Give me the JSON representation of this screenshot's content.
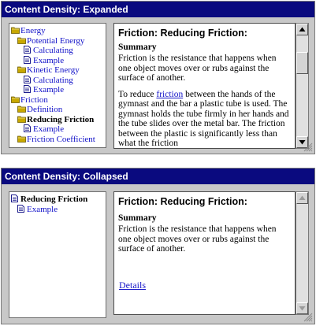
{
  "expanded": {
    "title": "Content Density: Expanded",
    "tree": [
      {
        "label": "Energy",
        "type": "folder",
        "level": 0
      },
      {
        "label": "Potential Energy",
        "type": "folder",
        "level": 1
      },
      {
        "label": "Calculating",
        "type": "doc",
        "level": 2
      },
      {
        "label": "Example",
        "type": "doc",
        "level": 2
      },
      {
        "label": "Kinetic Energy",
        "type": "folder",
        "level": 1
      },
      {
        "label": "Calculating",
        "type": "doc",
        "level": 2
      },
      {
        "label": "Example",
        "type": "doc",
        "level": 2
      },
      {
        "label": "Friction",
        "type": "folder",
        "level": 0
      },
      {
        "label": "Definition",
        "type": "folder",
        "level": 1
      },
      {
        "label": "Reducing Friction",
        "type": "folder",
        "level": 1,
        "current": true
      },
      {
        "label": "Example",
        "type": "doc",
        "level": 2
      },
      {
        "label": "Friction Coefficient",
        "type": "folder",
        "level": 1
      }
    ],
    "content_title": "Friction: Reducing Friction:",
    "summary_heading": "Summary",
    "summary_text": "Friction is the resistance that happens when one object moves over or rubs against the surface of another.",
    "body_before_link": "To reduce ",
    "body_link": "friction",
    "body_after_link": " between the hands of the gymnast and the bar a plastic tube is used. The gymnast holds the tube firmly in her hands and the tube slides over the metal bar. The friction between the plastic is significantly less than what the friction"
  },
  "collapsed": {
    "title": "Content Density: Collapsed",
    "tree": [
      {
        "label": "Reducing Friction",
        "type": "doc",
        "level": 0,
        "current": true
      },
      {
        "label": "Example",
        "type": "doc",
        "level": 1
      }
    ],
    "content_title": "Friction: Reducing Friction:",
    "summary_heading": "Summary",
    "summary_text": "Friction is the resistance that happens when one object moves over or rubs against the surface of another.",
    "details_link": "Details"
  },
  "icons": {
    "folder": "folder-icon",
    "document": "document-icon",
    "scroll_up": "arrow-up-icon",
    "scroll_down": "arrow-down-icon",
    "resize": "resize-grip-icon"
  },
  "colors": {
    "title_bar": "#0a0a7f",
    "panel_bg": "#c8c8c8",
    "link": "#1515c8",
    "folder": "#c8a800",
    "document": "#1c1c8c"
  }
}
